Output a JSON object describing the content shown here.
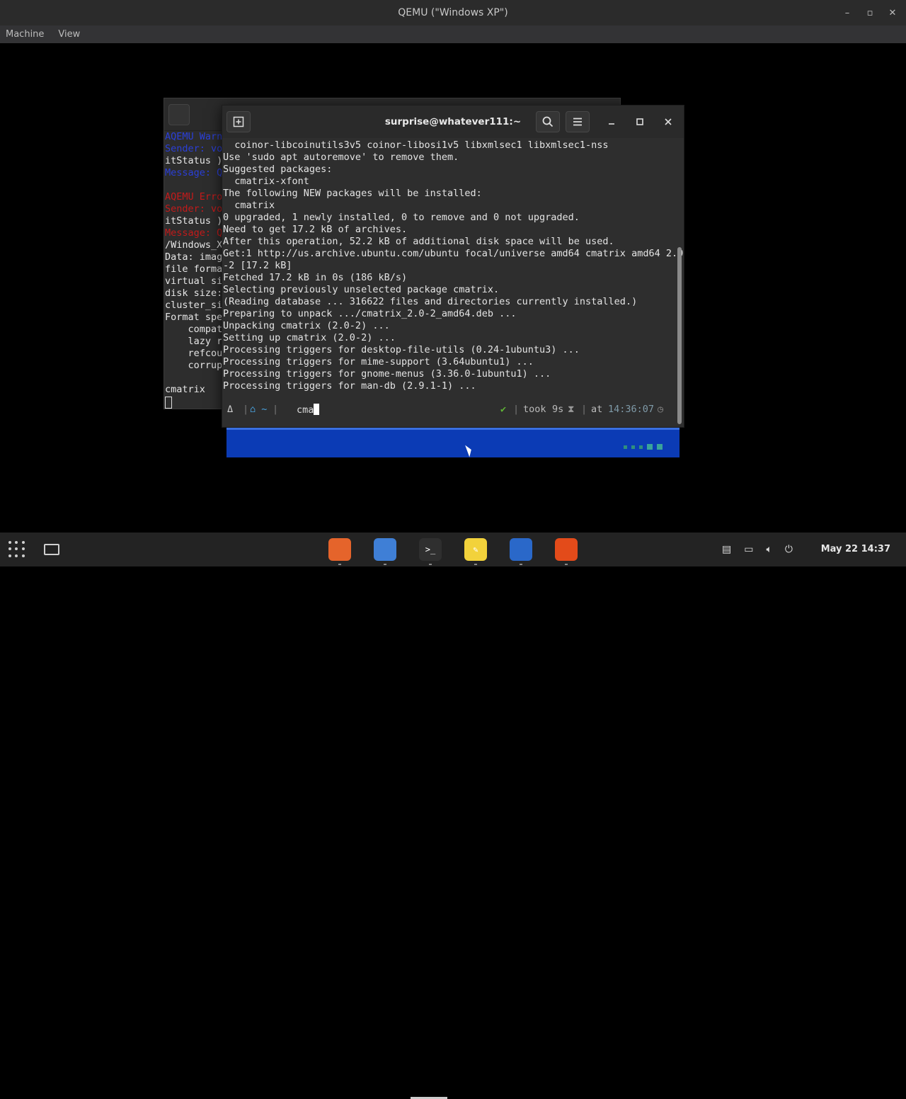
{
  "qemu": {
    "title": "QEMU (\"Windows XP\")",
    "menu": [
      "Machine",
      "View"
    ],
    "window_controls": [
      "–",
      "▫",
      "✕"
    ]
  },
  "back_terminal": {
    "lines": [
      {
        "text": "AQEMU Warn",
        "color": "blue"
      },
      {
        "text": "Sender: vo",
        "color": "blue"
      },
      {
        "text": "itStatus )",
        "color": "normal"
      },
      {
        "text": "Message: Q",
        "color": "blue"
      },
      {
        "text": "",
        "color": "normal"
      },
      {
        "text": "AQEMU Erro",
        "color": "red"
      },
      {
        "text": "Sender: vo",
        "color": "red"
      },
      {
        "text": "itStatus )",
        "color": "normal"
      },
      {
        "text": "Message: Q",
        "color": "red"
      },
      {
        "text": "/Windows_X",
        "color": "normal"
      },
      {
        "text": "Data: imag",
        "color": "normal"
      },
      {
        "text": "file forma",
        "color": "normal"
      },
      {
        "text": "virtual si",
        "color": "normal"
      },
      {
        "text": "disk size:",
        "color": "normal"
      },
      {
        "text": "cluster_si",
        "color": "normal"
      },
      {
        "text": "Format spe",
        "color": "normal"
      },
      {
        "text": "    compat",
        "color": "normal"
      },
      {
        "text": "    lazy r",
        "color": "normal"
      },
      {
        "text": "    refcou",
        "color": "normal"
      },
      {
        "text": "    corrup",
        "color": "normal"
      },
      {
        "text": "",
        "color": "normal"
      },
      {
        "text": "cmatrix",
        "color": "normal"
      }
    ]
  },
  "front_terminal": {
    "title": "surprise@whatever111:~",
    "lines": [
      "  coinor-libcoinutils3v5 coinor-libosi1v5 libxmlsec1 libxmlsec1-nss",
      "Use 'sudo apt autoremove' to remove them.",
      "Suggested packages:",
      "  cmatrix-xfont",
      "The following NEW packages will be installed:",
      "  cmatrix",
      "0 upgraded, 1 newly installed, 0 to remove and 0 not upgraded.",
      "Need to get 17.2 kB of archives.",
      "After this operation, 52.2 kB of additional disk space will be used.",
      "Get:1 http://us.archive.ubuntu.com/ubuntu focal/universe amd64 cmatrix amd64 2.0",
      "-2 [17.2 kB]",
      "Fetched 17.2 kB in 0s (186 kB/s)",
      "Selecting previously unselected package cmatrix.",
      "(Reading database ... 316622 files and directories currently installed.)",
      "Preparing to unpack .../cmatrix_2.0-2_amd64.deb ...",
      "Unpacking cmatrix (2.0-2) ...",
      "Setting up cmatrix (2.0-2) ...",
      "Processing triggers for desktop-file-utils (0.24-1ubuntu3) ...",
      "Processing triggers for mime-support (3.64ubuntu1) ...",
      "Processing triggers for gnome-menus (3.36.0-1ubuntu1) ...",
      "Processing triggers for man-db (2.9.1-1) ..."
    ],
    "prompt": {
      "os_icon": "Δ",
      "dir": "⌂ ~",
      "command": "cma",
      "status": "✔",
      "took_label": "took",
      "took_value": "9s",
      "at_label": "at",
      "time": "14:36:07"
    }
  },
  "dock": {
    "apps": [
      {
        "name": "firefox-icon",
        "glyph": "",
        "color": "#e5642b"
      },
      {
        "name": "file-manager-icon",
        "glyph": "",
        "color": "#3f7fd6"
      },
      {
        "name": "terminal-icon",
        "glyph": ">_",
        "color": "#2f2f2f"
      },
      {
        "name": "text-editor-icon",
        "glyph": "✎",
        "color": "#f2d23b"
      },
      {
        "name": "browser-icon",
        "glyph": "",
        "color": "#2a68c9"
      },
      {
        "name": "bird-app-icon",
        "glyph": "",
        "color": "#e34b1a"
      }
    ],
    "clock": "May 22  14:37"
  },
  "colors": {
    "xp_taskbar": "#0b3bb5",
    "prompt_accent": "#4aa3df",
    "status_ok": "#5fb336",
    "time_color": "#7f9aa8"
  }
}
